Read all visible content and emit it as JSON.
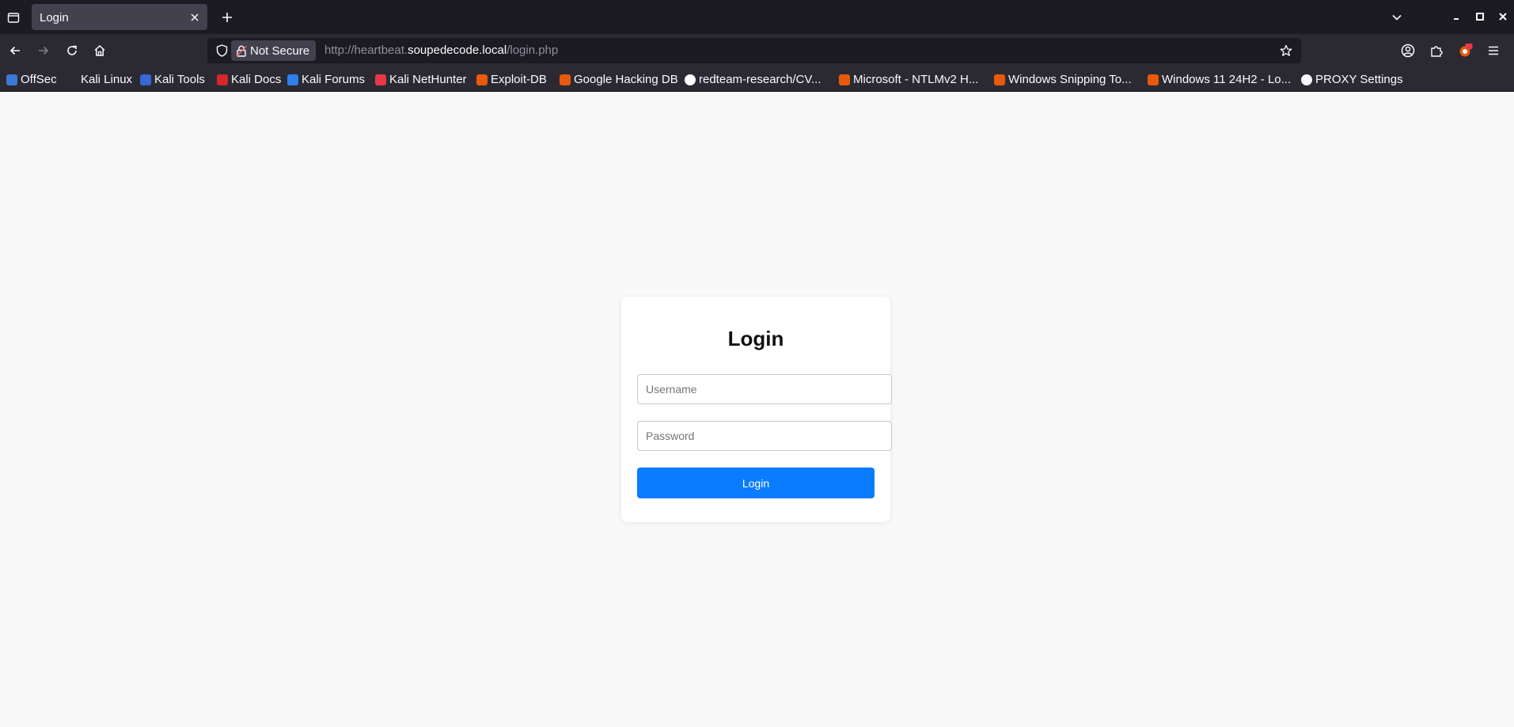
{
  "browser": {
    "tab": {
      "title": "Login"
    },
    "url": {
      "security_label": "Not Secure",
      "prefix": "http://heartbeat.",
      "host": "soupedecode.local",
      "path": "/login.php"
    },
    "bookmarks": [
      {
        "label": "OffSec",
        "color": "#3a7bd5"
      },
      {
        "label": "Kali Linux",
        "color": "#2b2a33"
      },
      {
        "label": "Kali Tools",
        "color": "#3867d6"
      },
      {
        "label": "Kali Docs",
        "color": "#d62828"
      },
      {
        "label": "Kali Forums",
        "color": "#2f80ed"
      },
      {
        "label": "Kali NetHunter",
        "color": "#e63946"
      },
      {
        "label": "Exploit-DB",
        "color": "#e8590c"
      },
      {
        "label": "Google Hacking DB",
        "color": "#e8590c"
      },
      {
        "label": "redteam-research/CV...",
        "color": "#ffffff"
      },
      {
        "label": "Microsoft - NTLMv2 H...",
        "color": "#e8590c"
      },
      {
        "label": "Windows Snipping To...",
        "color": "#e8590c"
      },
      {
        "label": "Windows 11 24H2 - Lo...",
        "color": "#e8590c"
      },
      {
        "label": "PROXY Settings",
        "color": "#fbfbfe"
      }
    ]
  },
  "login": {
    "title": "Login",
    "username_placeholder": "Username",
    "password_placeholder": "Password",
    "button_label": "Login",
    "accent_color": "#0a7cff"
  }
}
